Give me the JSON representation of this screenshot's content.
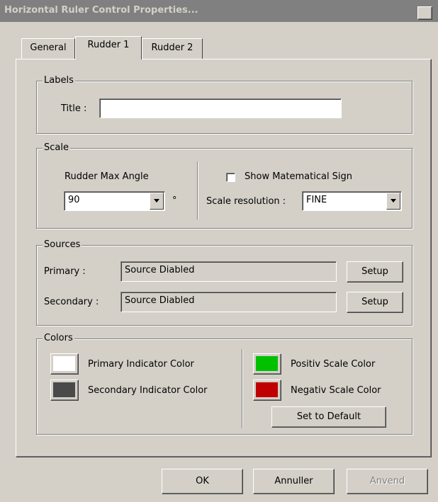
{
  "window": {
    "title": "Horizontal Ruler Control Properties...",
    "close": "×"
  },
  "tabs": [
    "General",
    "Rudder 1",
    "Rudder 2"
  ],
  "labels": {
    "legend": "Labels",
    "title_label": "Title :",
    "title_value": ""
  },
  "scale": {
    "legend": "Scale",
    "max_angle_label": "Rudder Max Angle",
    "max_angle_value": "90",
    "degree": "°",
    "show_sign_label": "Show Matematical Sign",
    "show_sign_checked": false,
    "resolution_label": "Scale resolution :",
    "resolution_value": "FINE"
  },
  "sources": {
    "legend": "Sources",
    "primary_label": "Primary :",
    "primary_value": "Source Diabled",
    "secondary_label": "Secondary :",
    "secondary_value": "Source Diabled",
    "setup_label": "Setup"
  },
  "colors": {
    "legend": "Colors",
    "primary_label": "Primary Indicator Color",
    "primary_color": "#ffffff",
    "secondary_label": "Secondary Indicator Color",
    "secondary_color": "#4a4a4a",
    "positive_label": "Positiv Scale Color",
    "positive_color": "#00c000",
    "negative_label": "Negativ Scale Color",
    "negative_color": "#c00000",
    "default_label": "Set to Default"
  },
  "footer": {
    "ok": "OK",
    "cancel": "Annuller",
    "apply": "Anvend"
  }
}
